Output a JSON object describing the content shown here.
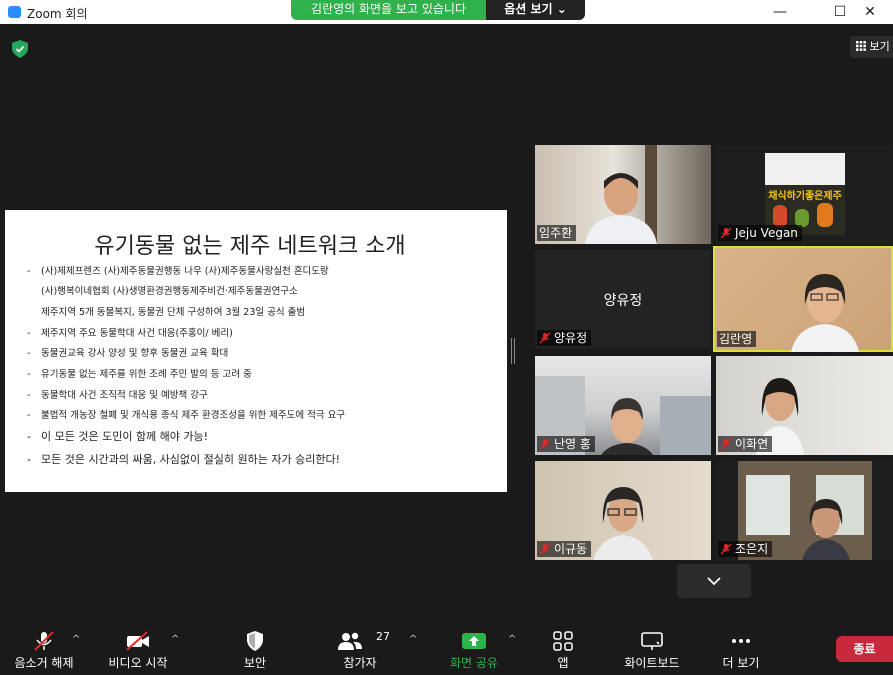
{
  "window": {
    "title": "Zoom 회의",
    "minimize": "—",
    "maximize": "☐",
    "close": "✕"
  },
  "share_banner": {
    "text": "김란영의 화면을 보고 있습니다",
    "options_label": "옵션 보기 ⌄"
  },
  "view_button": {
    "label": "보기"
  },
  "slide": {
    "title": "유기동물 없는 제주 네트워크 소개",
    "lines": [
      {
        "dash": "-",
        "text": "(사)제제프렌즈 (사)제주동물권행동 나우 (사)제주동물사랑실천 혼디도랑"
      },
      {
        "dash": "",
        "text": "(사)행복이네협회 (사)생명환경권행동제주비건·제주동물권연구소"
      },
      {
        "dash": "",
        "text": "제주지역 5개 동물복지, 동물권 단체 구성하여 3월 23일 공식 출범"
      },
      {
        "dash": "-",
        "text": "제주지역 주요 동물학대 사건 대응(주홍이/ 베리)"
      },
      {
        "dash": "-",
        "text": "동물권교육 강사 양성 및 향후 동물권 교육 확대"
      },
      {
        "dash": "-",
        "text": "유기동물 없는 제주를 위한 조례 주민 발의 등 고려 중"
      },
      {
        "dash": "-",
        "text": "동물학대 사건 조직적 대응 및 예방책 강구"
      },
      {
        "dash": "-",
        "text": "불법적 개농장 철폐 및 개식용 종식 제주 환경조성을 위한 제주도에 적극 요구"
      },
      {
        "dash": "-",
        "text": "이 모든 것은 도민이 함께 해야 가능!"
      },
      {
        "dash": "-",
        "text": "모든 것은 시간과의 싸움, 사심없이 절실히 원하는 자가 승리한다!"
      }
    ]
  },
  "participants": [
    {
      "name": "임주환",
      "muted": false
    },
    {
      "name": "Jeju Vegan",
      "muted": true,
      "poster_text": "채식하기좋은제주"
    },
    {
      "name": "양유정",
      "muted": true
    },
    {
      "name": "김란영",
      "muted": false
    },
    {
      "name": "난영 홍",
      "muted": true
    },
    {
      "name": "이화연",
      "muted": true
    },
    {
      "name": "이규동",
      "muted": true
    },
    {
      "name": "조은지",
      "muted": true
    }
  ],
  "toolbar": {
    "unmute": "음소거 해제",
    "start_video": "비디오 시작",
    "security": "보안",
    "participants": "참가자",
    "participants_count": "27",
    "share_screen": "화면 공유",
    "apps": "앱",
    "whiteboard": "화이트보드",
    "more": "더 보기",
    "end": "종료"
  },
  "colors": {
    "share_green": "#2fb24c",
    "active_speaker": "#d5e23a",
    "end_red": "#c8283c",
    "muted_red": "#e02828"
  }
}
